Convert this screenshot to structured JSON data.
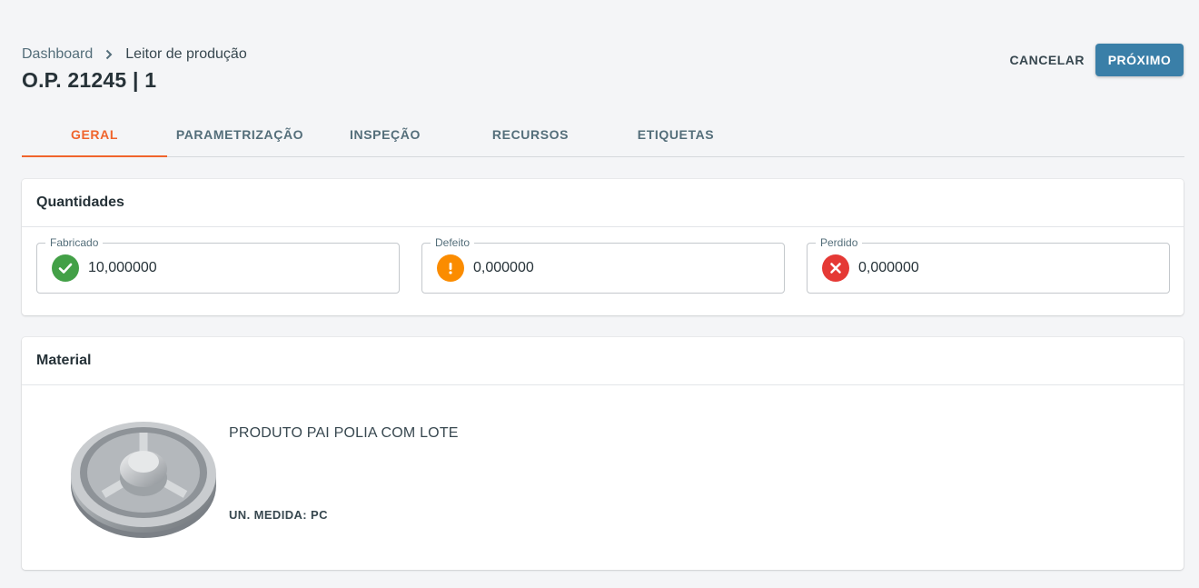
{
  "breadcrumb": {
    "root": "Dashboard",
    "current": "Leitor de produção"
  },
  "page_title": "O.P. 21245 | 1",
  "actions": {
    "cancel": "CANCELAR",
    "next": "PRÓXIMO"
  },
  "tabs": [
    {
      "label": "GERAL",
      "active": true
    },
    {
      "label": "PARAMETRIZAÇÃO",
      "active": false
    },
    {
      "label": "INSPEÇÃO",
      "active": false
    },
    {
      "label": "RECURSOS",
      "active": false
    },
    {
      "label": "ETIQUETAS",
      "active": false
    }
  ],
  "quantities": {
    "title": "Quantidades",
    "fields": [
      {
        "label": "Fabricado",
        "value": "10,000000",
        "icon": "check-circle-icon",
        "color": "#43a047"
      },
      {
        "label": "Defeito",
        "value": "0,000000",
        "icon": "warning-circle-icon",
        "color": "#fb8c00"
      },
      {
        "label": "Perdido",
        "value": "0,000000",
        "icon": "error-circle-icon",
        "color": "#e53935"
      }
    ]
  },
  "material": {
    "title": "Material",
    "product_name": "PRODUTO PAI POLIA COM LOTE",
    "unit": "UN. MEDIDA: PC"
  },
  "colors": {
    "accent": "#f0642c",
    "primary": "#3a7fa8"
  }
}
